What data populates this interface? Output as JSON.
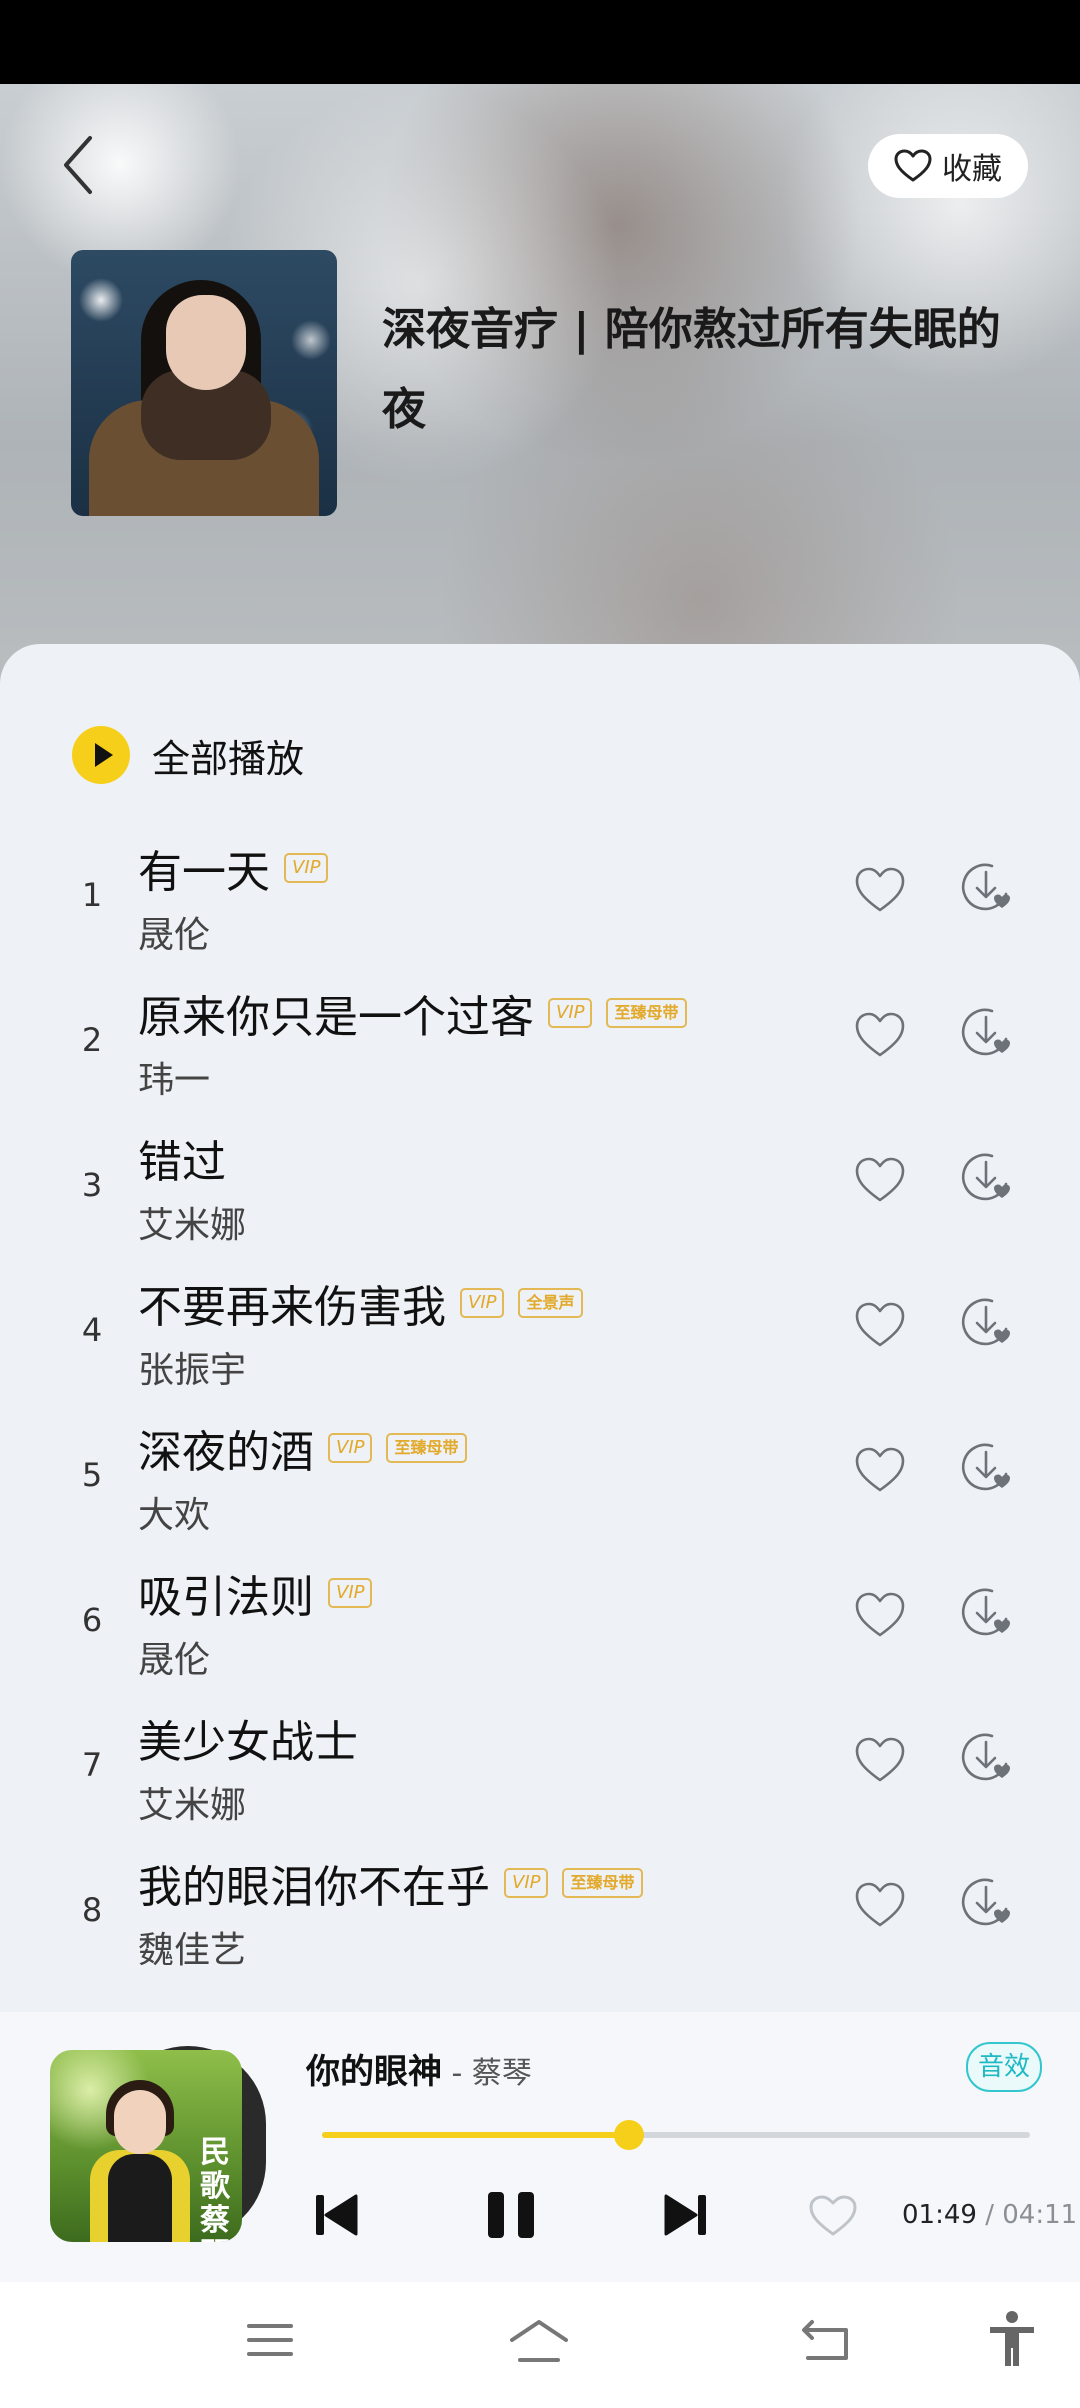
{
  "header": {
    "favorite_label": "收藏"
  },
  "playlist": {
    "title": "深夜音疗 | 陪你熬过所有失眠的夜"
  },
  "play_all": {
    "label": "全部播放"
  },
  "songs": [
    {
      "index": "1",
      "title": "有一天",
      "artist": "晟伦",
      "tags": [
        "VIP"
      ]
    },
    {
      "index": "2",
      "title": "原来你只是一个过客",
      "artist": "玮一",
      "tags": [
        "VIP",
        "至臻母带"
      ]
    },
    {
      "index": "3",
      "title": "错过",
      "artist": "艾米娜",
      "tags": []
    },
    {
      "index": "4",
      "title": "不要再来伤害我",
      "artist": "张振宇",
      "tags": [
        "VIP",
        "全景声"
      ]
    },
    {
      "index": "5",
      "title": "深夜的酒",
      "artist": "大欢",
      "tags": [
        "VIP",
        "至臻母带"
      ]
    },
    {
      "index": "6",
      "title": "吸引法则",
      "artist": "晟伦",
      "tags": [
        "VIP"
      ]
    },
    {
      "index": "7",
      "title": "美少女战士",
      "artist": "艾米娜",
      "tags": []
    },
    {
      "index": "8",
      "title": "我的眼泪你不在乎",
      "artist": "魏佳艺",
      "tags": [
        "VIP",
        "至臻母带"
      ]
    }
  ],
  "player": {
    "title": "你的眼神",
    "artist_sep": " - ",
    "artist": "蔡琴",
    "effect_label": "音效",
    "album_text": "民歌蔡琴",
    "elapsed": "01:49",
    "separator": " / ",
    "total": "04:11",
    "progress": 0.434
  },
  "colors": {
    "accent": "#f6cf1a",
    "effect": "#1fb9c4",
    "tag": "#e2a92a"
  },
  "icons": {
    "back": "chevron-left-icon",
    "favorite": "heart-icon",
    "download": "download-heart-icon",
    "prev": "skip-previous-icon",
    "pause": "pause-icon",
    "next": "skip-next-icon",
    "nav": [
      "menu-icon",
      "home-icon",
      "back-nav-icon",
      "accessibility-icon"
    ]
  }
}
